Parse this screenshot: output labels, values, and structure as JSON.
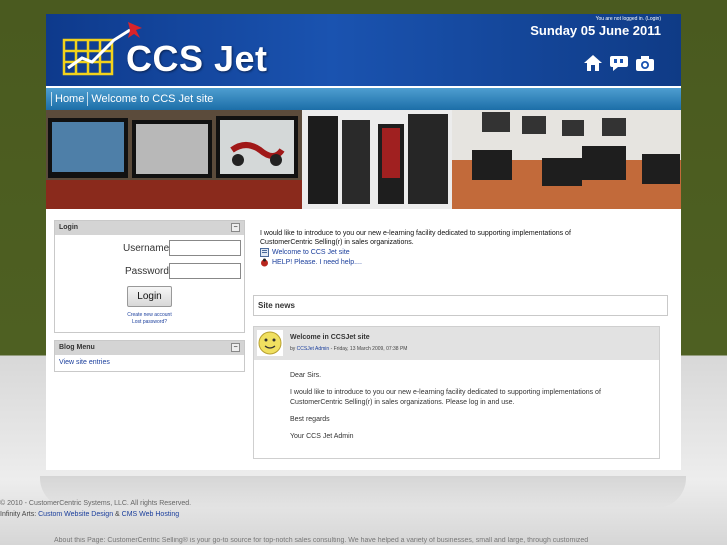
{
  "header": {
    "site_title": "CCS Jet",
    "login_status": "You are not logged in. (Login)",
    "date": "Sunday 05 June 2011",
    "icons": [
      "home-icon",
      "chat-icon",
      "camera-icon"
    ]
  },
  "nav": {
    "home": "Home",
    "current": "Welcome to CCS Jet site"
  },
  "login": {
    "title": "Login",
    "toggle": "−",
    "username_label": "Username",
    "password_label": "Password",
    "username_value": "",
    "password_value": "",
    "button": "Login",
    "create_account": "Create new account",
    "lost_password": "Lost password?"
  },
  "blog": {
    "title": "Blog Menu",
    "toggle": "−",
    "view_entries": "View site entries"
  },
  "intro": {
    "line1": "I would like to introduce to you our new e-learning facility dedicated to supporting implementations of",
    "line2": "CustomerCentric Selling(r) in sales organizations.",
    "link1": "Welcome to CCS Jet site",
    "link2": "HELP! Please.  I need help...."
  },
  "site_news": {
    "title": "Site news"
  },
  "post": {
    "title": "Welcome in CCSJet site",
    "by_prefix": "by ",
    "author": "CCSJet Admin",
    "date": " - Friday, 13 March 2009, 07:38 PM",
    "greeting": "Dear Sirs.",
    "para1_line1": "I would like to introduce to you our new e-learning facility dedicated to supporting implementations of",
    "para1_line2": "CustomerCentric Selling(r) in sales organizations. Please log in and use.",
    "regards": "Best regards",
    "signature": "Your CCS Jet Admin"
  },
  "footer": {
    "copyright": "© 2010 - CustomerCentric Systems, LLC. All rights Reserved.",
    "credit_prefix": "Infinity Arts: ",
    "credit_link1": "Custom Website Design",
    "credit_amp": " & ",
    "credit_link2": "CMS Web Hosting",
    "about": "About this Page: CustomerCentric Selling® is your go-to source for top-notch sales consulting. We have helped a variety of businesses, small and large, through customized"
  },
  "colors": {
    "header_blue": "#1a53b0",
    "nav_blue": "#2c82bd",
    "link_blue": "#1a3e9c",
    "block_header": "#d4d4d4"
  }
}
